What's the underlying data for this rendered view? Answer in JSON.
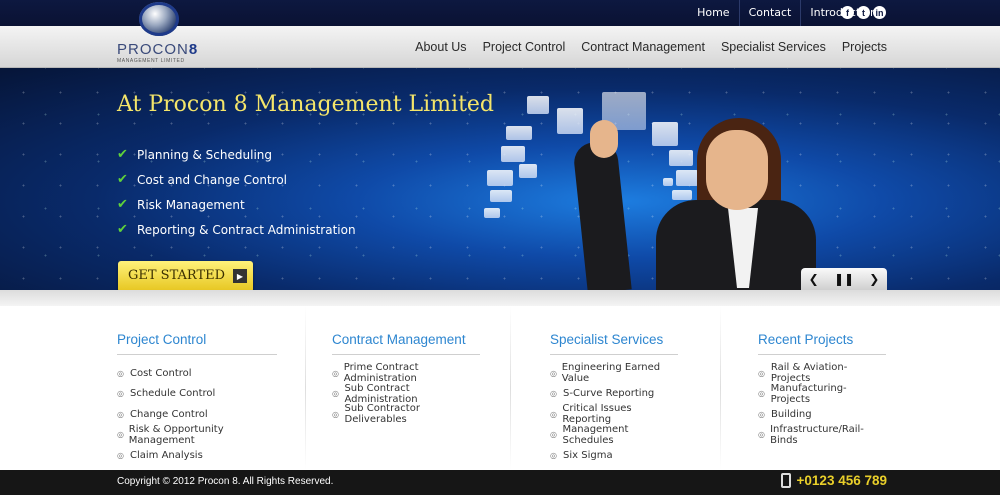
{
  "brand": {
    "name_main": "PROCON",
    "name_num": "8",
    "tagline": "MANAGEMENT LIMITED"
  },
  "topnav": [
    {
      "label": "Home"
    },
    {
      "label": "Contact"
    },
    {
      "label": "Introduction"
    }
  ],
  "social": [
    {
      "icon": "facebook-icon",
      "glyph": "f"
    },
    {
      "icon": "twitter-icon",
      "glyph": "t"
    },
    {
      "icon": "linkedin-icon",
      "glyph": "in"
    }
  ],
  "mainnav": [
    {
      "label": "About Us"
    },
    {
      "label": "Project Control"
    },
    {
      "label": "Contract Management"
    },
    {
      "label": "Specialist Services"
    },
    {
      "label": "Projects"
    }
  ],
  "hero": {
    "title": "At Procon 8 Management Limited",
    "bullets": [
      "Planning & Scheduling",
      "Cost and Change Control",
      "Risk Management",
      "Reporting & Contract Administration"
    ],
    "cta_label": "GET STARTED",
    "cta_icon": "arrow-right-icon",
    "slider": {
      "prev": "❮",
      "pause": "❚❚",
      "next": "❯"
    }
  },
  "columns": [
    {
      "title": "Project Control",
      "items": [
        "Cost Control",
        "Schedule Control",
        "Change Control",
        "Risk & Opportunity Management",
        "Claim Analysis"
      ]
    },
    {
      "title": "Contract Management",
      "items": [
        "Prime Contract Administration",
        "Sub Contract Administration",
        "Sub Contractor Deliverables"
      ]
    },
    {
      "title": "Specialist Services",
      "items": [
        "Engineering Earned Value",
        "S-Curve Reporting",
        "Critical Issues Reporting",
        "Management Schedules",
        "Six Sigma"
      ]
    },
    {
      "title": "Recent Projects",
      "items": [
        "Rail & Aviation-Projects",
        "Manufacturing- Projects",
        "Building",
        "Infrastructure/Rail- Binds"
      ]
    }
  ],
  "footer": {
    "copyright": "Copyright © 2012 Procon 8. All Rights Reserved.",
    "phone": "+0123 456 789"
  },
  "colors": {
    "accent_blue": "#2d86d0",
    "cta_yellow": "#e6c51e",
    "title_yellow": "#f4e56a",
    "nav_dark": "#0d1840"
  }
}
